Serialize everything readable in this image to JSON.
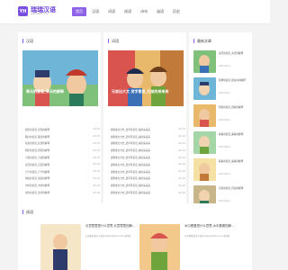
{
  "brand": {
    "title": "瑞瑞汉语",
    "subtitle": "RUIRUIHANYU.COM",
    "mark": "YH"
  },
  "nav": [
    "首页",
    "汉语",
    "词语",
    "成语",
    "诗句",
    "谜语",
    "历史"
  ],
  "sections": {
    "left": {
      "title": "汉语",
      "feature_caption": "青天的意思_青天的解释",
      "items": [
        {
          "title": "惹伤的意思_惹伤的解释",
          "date": "06-16"
        },
        {
          "title": "嚼过的意思_嚼过的解释",
          "date": "06-16"
        },
        {
          "title": "狂愚的意思_狂愚的解释",
          "date": "06-16"
        },
        {
          "title": "阴影的意思_阴影的解释",
          "date": "06-16"
        },
        {
          "title": "乌滴的意思_乌滴的解释",
          "date": "06-16"
        },
        {
          "title": "盲目的意思_盲目的解释",
          "date": "06-16"
        },
        {
          "title": "卢宁的意思_卢宁的解释",
          "date": "06-16"
        },
        {
          "title": "胡说的意思_胡说的解释",
          "date": "06-16"
        },
        {
          "title": "乍听的意思_乍听的解释",
          "date": "06-16"
        },
        {
          "title": "沈约的意思_沈约的解释",
          "date": "06-16"
        }
      ]
    },
    "middle": {
      "title": "词语",
      "feature_caption": "兄弟出大文 发字意思_兄弟的来来来",
      "items": [
        {
          "title": "唐朝成立大史_晨早等意思_看的来来来",
          "date": "06-16"
        },
        {
          "title": "唐朝成立大史_晨早等意思_看的来来来",
          "date": "06-16"
        },
        {
          "title": "唐朝成立大史_晨早等意思_看的来来来",
          "date": "06-16"
        },
        {
          "title": "唐朝成立大史_晨早等意思_看的来来来",
          "date": "06-16"
        },
        {
          "title": "唐朝成立大史_晨早等意思_看的来来来",
          "date": "06-16"
        },
        {
          "title": "唐朝成立大史_晨早等意思_看的来来来",
          "date": "06-16"
        },
        {
          "title": "唐朝成立大史_晨早等意思_看的来来来",
          "date": "06-16"
        },
        {
          "title": "唐朝成立大史_晨早等意思_看的来来来",
          "date": "06-16"
        },
        {
          "title": "唐朝成立大史_晨早等意思_看的来来来",
          "date": "06-16"
        },
        {
          "title": "唐朝成立大史_晨早等意思_看的来来来",
          "date": "06-16"
        }
      ]
    },
    "right": {
      "title": "最新文章",
      "items": [
        {
          "title": "青天的意思_青天的解释",
          "date": "2025-06-16"
        },
        {
          "title": "现场的意思_现在时的解释",
          "date": "2025-06-16"
        },
        {
          "title": "想着的意思_想着的解释",
          "date": "2025-06-16"
        },
        {
          "title": "看看的意思_看看的解释",
          "date": "2025-06-16"
        },
        {
          "title": "看看的意思_看看的解释",
          "date": "2025-06-16"
        },
        {
          "title": "问说的意思_问说的解释",
          "date": "2025-06-16"
        }
      ]
    },
    "bottom": {
      "title": "成语",
      "cards": [
        {
          "title": "长意惹惹是什么意思,长意惹惹的解...",
          "desc": "长意惹惹是什么意思 www.jijiihan.com 发明者"
        },
        {
          "title": "水中看看是什么意思,水中看看的解...",
          "desc": "水中看看是什么意思 www.jijiihan.com 发明者"
        }
      ]
    }
  },
  "colors": {
    "accent": "#8e63e8"
  }
}
